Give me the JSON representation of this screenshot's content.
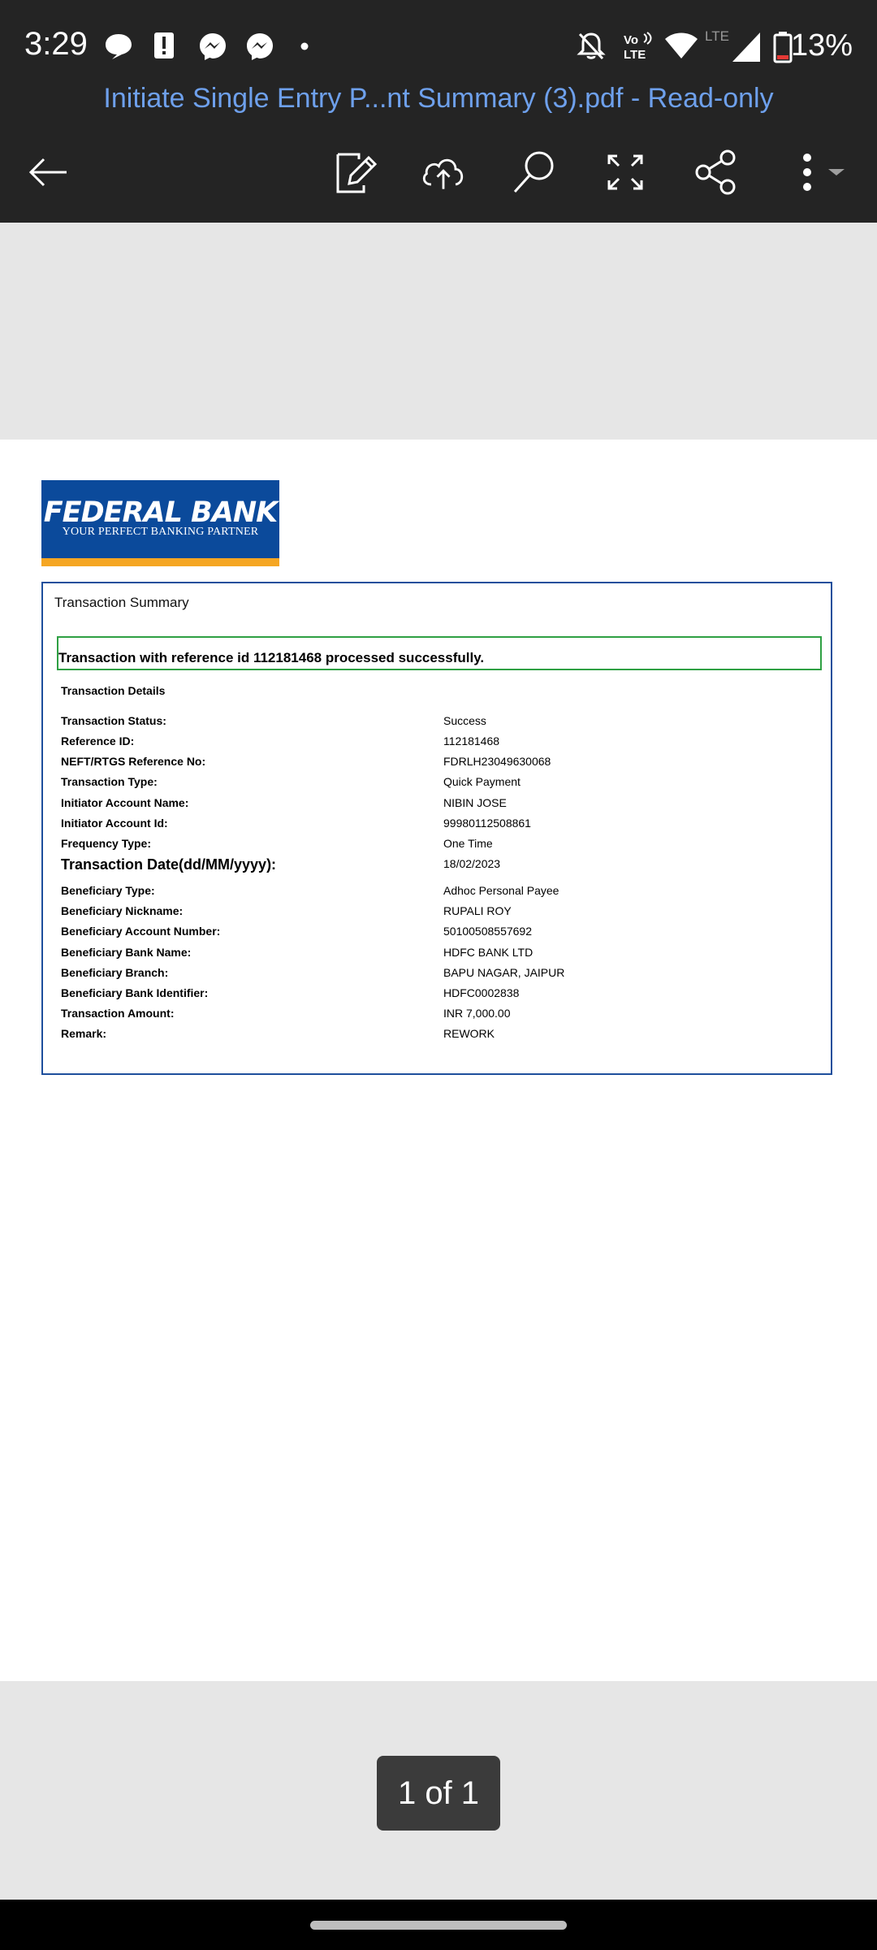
{
  "status_bar": {
    "time": "3:29",
    "battery": "13%",
    "network": "LTE",
    "volte": "Vo LTE"
  },
  "title_bar": {
    "document_title": "Initiate Single Entry P...nt Summary (3).pdf - Read-only"
  },
  "toolbar": {
    "icons": [
      "back-arrow-icon",
      "edit-icon",
      "cloud-upload-icon",
      "search-icon",
      "fullscreen-icon",
      "share-icon",
      "more-vert-icon"
    ]
  },
  "document": {
    "logo": {
      "name": "FEDERAL BANK",
      "tagline": "YOUR PERFECT BANKING PARTNER"
    },
    "summary_title": "Transaction Summary",
    "success_message": "Transaction with reference id 112181468 processed successfully.",
    "details_heading": "Transaction Details",
    "rows": [
      {
        "label": "Transaction Status:",
        "value": "Success"
      },
      {
        "label": "Reference ID:",
        "value": "112181468"
      },
      {
        "label": "NEFT/RTGS Reference No:",
        "value": "FDRLH23049630068"
      },
      {
        "label": "Transaction Type:",
        "value": "Quick Payment"
      },
      {
        "label": "Initiator Account Name:",
        "value": "NIBIN JOSE"
      },
      {
        "label": "Initiator Account Id:",
        "value": "99980112508861"
      },
      {
        "label": "Frequency Type:",
        "value": "One Time"
      },
      {
        "label": "Transaction Date(dd/MM/yyyy):",
        "value": "18/02/2023"
      },
      {
        "label": "Beneficiary Type:",
        "value": "Adhoc Personal Payee"
      },
      {
        "label": "Beneficiary Nickname:",
        "value": "RUPALI ROY"
      },
      {
        "label": "Beneficiary Account Number:",
        "value": "50100508557692"
      },
      {
        "label": "Beneficiary Bank Name:",
        "value": "HDFC BANK LTD"
      },
      {
        "label": "Beneficiary Branch:",
        "value": "BAPU NAGAR, JAIPUR"
      },
      {
        "label": "Beneficiary Bank Identifier:",
        "value": "HDFC0002838"
      },
      {
        "label": "Transaction Amount:",
        "value": "INR 7,000.00"
      },
      {
        "label": "Remark:",
        "value": "REWORK"
      }
    ]
  },
  "pager": {
    "label": "1 of 1"
  },
  "colors": {
    "app_bar": "#242424",
    "title_text": "#6ea0ec",
    "brand_blue": "#0b4a9b",
    "brand_orange": "#f5a623",
    "success_border": "#2ea043"
  }
}
